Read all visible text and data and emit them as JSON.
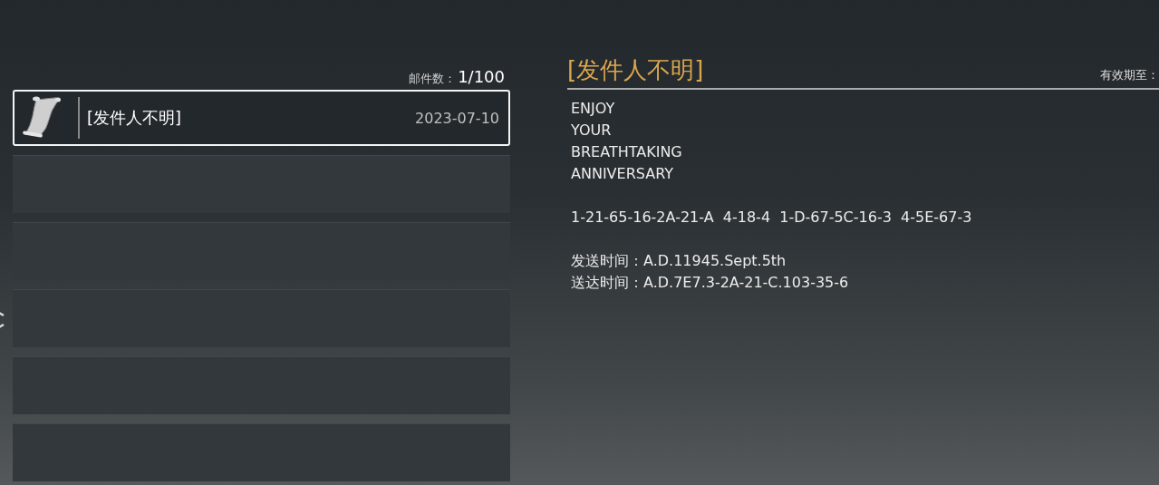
{
  "mail_count": {
    "label": "邮件数：",
    "value": "1/100"
  },
  "slots": [
    {
      "kind": "mail",
      "sender": "[发件人不明]",
      "date": "2023-07-10",
      "selected": true
    },
    {
      "kind": "empty"
    },
    {
      "kind": "empty"
    },
    {
      "kind": "empty"
    },
    {
      "kind": "empty"
    },
    {
      "kind": "empty"
    }
  ],
  "detail": {
    "title": "[发件人不明]",
    "expiry_label": "有效期至：",
    "paragraphs": [
      [
        "ENJOY",
        "YOUR",
        "BREATHTAKING",
        "ANNIVERSARY"
      ],
      [
        "1-21-65-16-2A-21-A  4-18-4  1-D-67-5C-16-3  4-5E-67-3"
      ],
      [
        "发送时间：A.D.11945.Sept.5th",
        "送达时间：A.D.7E7.3-2A-21-C.103-35-6"
      ]
    ]
  }
}
